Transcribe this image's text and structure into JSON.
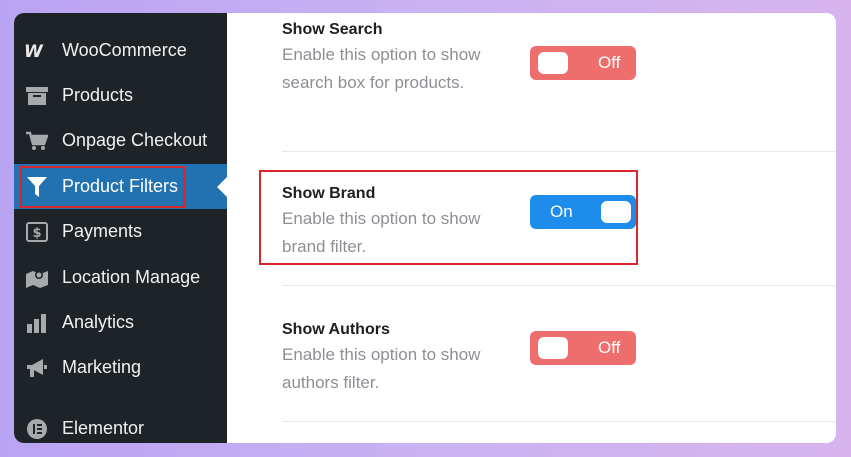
{
  "sidebar": {
    "items": [
      {
        "label": "WooCommerce",
        "icon": "woocommerce-icon"
      },
      {
        "label": "Products",
        "icon": "archive-box-icon"
      },
      {
        "label": "Onpage Checkout",
        "icon": "cart-icon"
      },
      {
        "label": "Product Filters",
        "icon": "funnel-icon",
        "active": true
      },
      {
        "label": "Payments",
        "icon": "dollar-icon"
      },
      {
        "label": "Location Manage",
        "icon": "map-pin-icon"
      },
      {
        "label": "Analytics",
        "icon": "bar-chart-icon"
      },
      {
        "label": "Marketing",
        "icon": "megaphone-icon"
      },
      {
        "label": "Elementor",
        "icon": "elementor-icon"
      }
    ]
  },
  "settings": [
    {
      "title": "Show Search",
      "description": "Enable this option to show search box for products.",
      "toggle_label": "Off",
      "state": "off"
    },
    {
      "title": "Show Brand",
      "description": "Enable this option to show brand filter.",
      "toggle_label": "On",
      "state": "on"
    },
    {
      "title": "Show Authors",
      "description": "Enable this option to show authors filter.",
      "toggle_label": "Off",
      "state": "off"
    }
  ],
  "colors": {
    "sidebar_bg": "#1e2327",
    "active_bg": "#2271b1",
    "toggle_off": "#ee6e6e",
    "toggle_on": "#1e8cea",
    "highlight": "#d9262b"
  }
}
